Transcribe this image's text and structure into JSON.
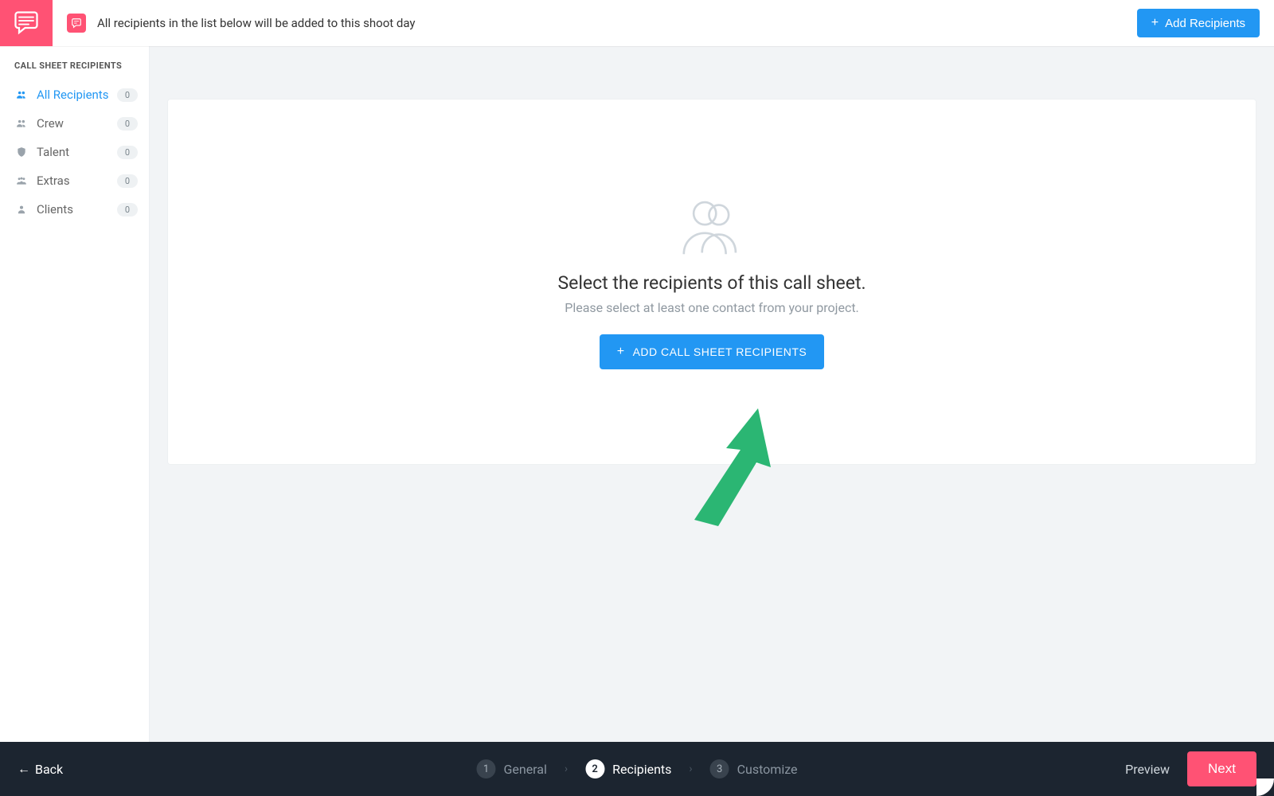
{
  "topbar": {
    "info_text": "All recipients in the list below will be added to this shoot day",
    "add_button": "Add Recipients"
  },
  "sidebar": {
    "title": "CALL SHEET RECIPIENTS",
    "items": [
      {
        "label": "All Recipients",
        "count": "0",
        "icon": "users",
        "active": true
      },
      {
        "label": "Crew",
        "count": "0",
        "icon": "users",
        "active": false
      },
      {
        "label": "Talent",
        "count": "0",
        "icon": "shield",
        "active": false
      },
      {
        "label": "Extras",
        "count": "0",
        "icon": "group",
        "active": false
      },
      {
        "label": "Clients",
        "count": "0",
        "icon": "person",
        "active": false
      }
    ]
  },
  "empty": {
    "heading": "Select the recipients of this call sheet.",
    "sub": "Please select at least one contact from your project.",
    "button": "ADD CALL SHEET RECIPIENTS"
  },
  "footer": {
    "back": "Back",
    "steps": [
      {
        "num": "1",
        "label": "General",
        "active": false
      },
      {
        "num": "2",
        "label": "Recipients",
        "active": true
      },
      {
        "num": "3",
        "label": "Customize",
        "active": false
      }
    ],
    "preview": "Preview",
    "next": "Next"
  }
}
